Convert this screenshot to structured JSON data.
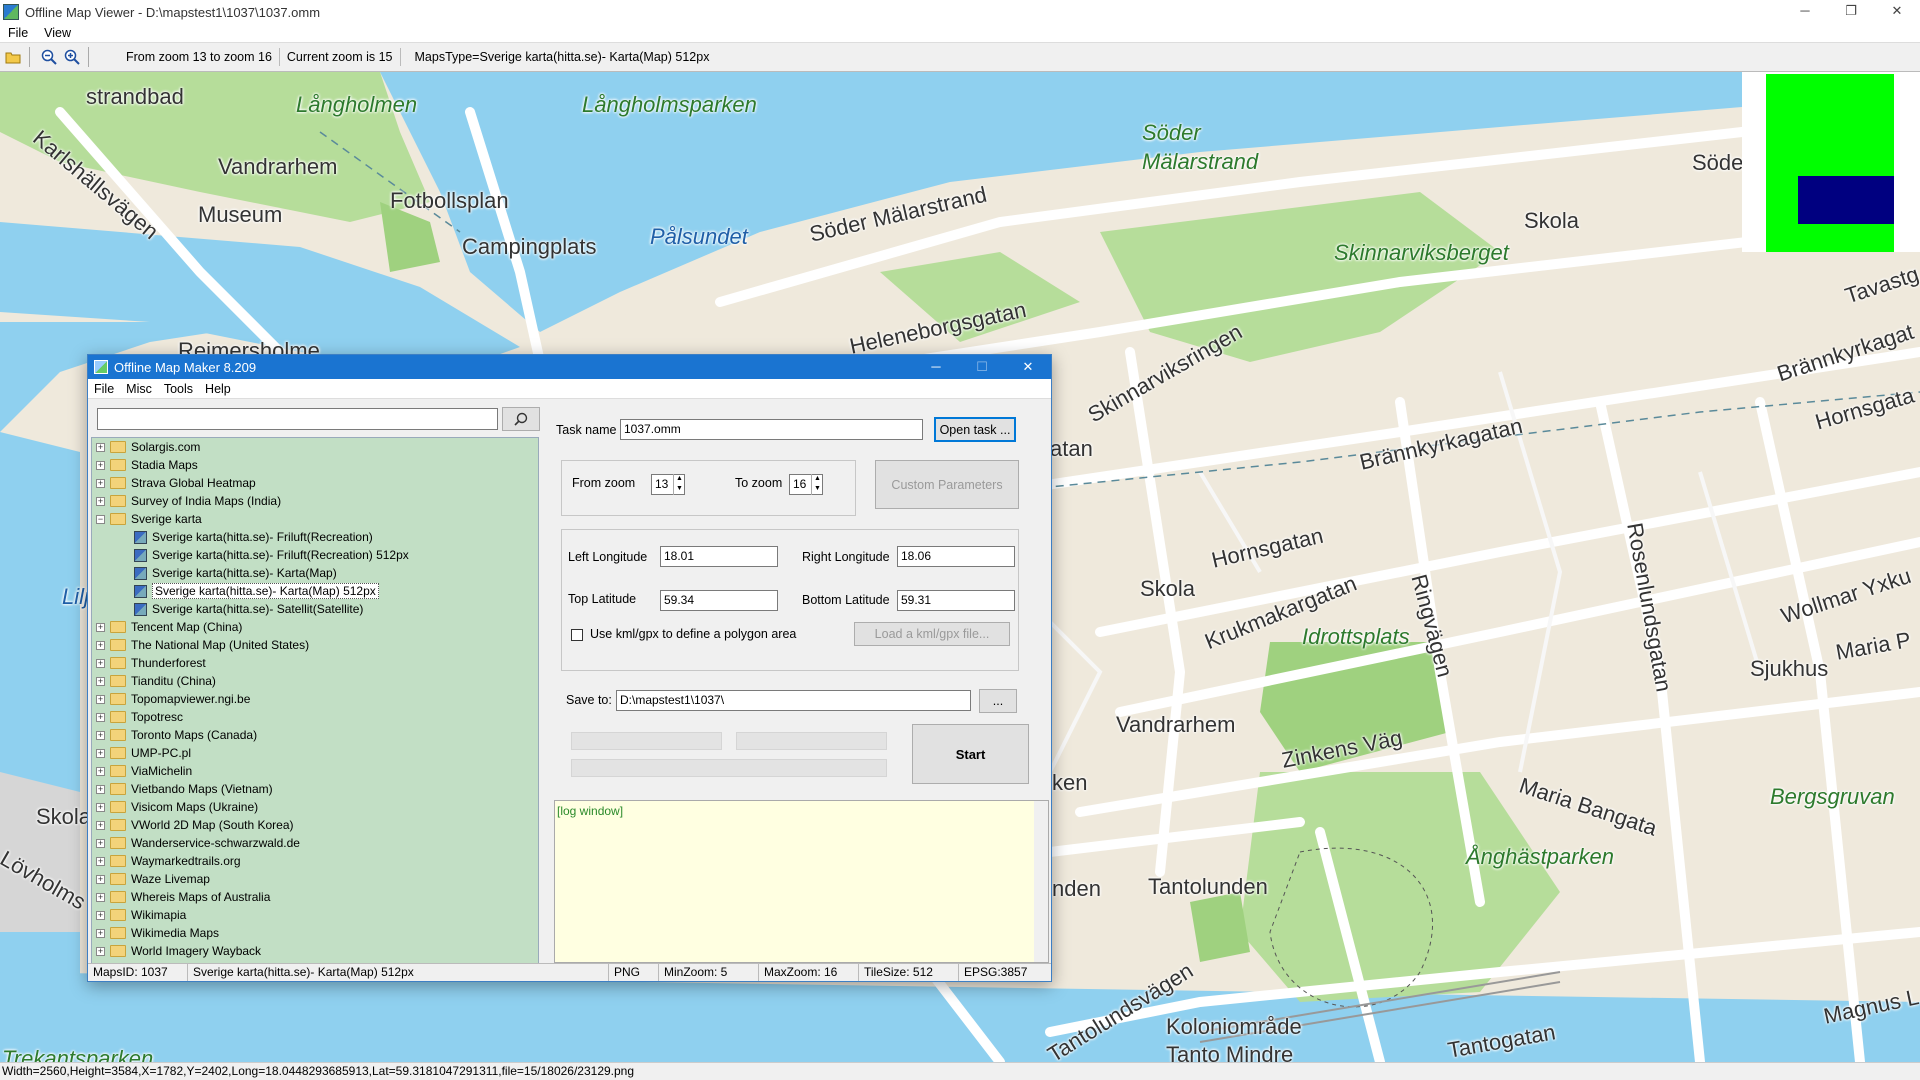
{
  "window": {
    "title": "Offline Map Viewer - D:\\mapstest1\\1037\\1037.omm",
    "minimize": "─",
    "restore": "❐",
    "close": "✕"
  },
  "menu": {
    "file": "File",
    "view": "View"
  },
  "toolbar": {
    "zoom_range": "From zoom 13 to zoom 16",
    "current_zoom": "Current zoom is 15",
    "maps_type": "MapsType=Sverige karta(hitta.se)- Karta(Map) 512px"
  },
  "map_labels": {
    "l1": "strandbad",
    "l2": "Långholmen",
    "l3": "Långholmsparken",
    "l4": "Söder",
    "l5": "Mälarstrand",
    "l6": "Vandrarhem",
    "l7": "Museum",
    "l8": "Fotbollsplan",
    "l9": "Campingplats",
    "l10": "Pålsundet",
    "l11": "Söder Mälarstrand",
    "l12": "Skola",
    "l13": "Skinnarviksberget",
    "l14": "Heleneborgsgatan",
    "l15": "Skinnarviksringen",
    "l16": "Tavastg",
    "l17": "Brännkyrkagat",
    "l18": "Hornsgata",
    "l19": "Brännkyrkagatan",
    "l20": "Hornsgatan",
    "l21": "Skola",
    "l22": "Krukmakargatan",
    "l23": "Idrottsplats",
    "l24": "Ringvägen",
    "l25": "Rosenlundsgatan",
    "l26": "Wollmar Yxku",
    "l27": "Sjukhus",
    "l28": "Maria P",
    "l29": "Vandrarhem",
    "l30": "Zinkens Väg",
    "l31": "Maria Bangata",
    "l32": "Bergsgruvan",
    "l33": "Tantolunden",
    "l34": "Ånghästparken",
    "l35": "Koloniområde",
    "l36": "Tanto Mindre",
    "l37": "Tantogatan",
    "l38": "Tantolundsvägen",
    "l39": "Magnus L",
    "l40": "Karlshällsvägen",
    "l41": "Skola",
    "l42": "Lövholms",
    "l43": "Lilj",
    "l44": "Söde",
    "l45": "Trekantsparken",
    "l46": "Reimersholme",
    "l47": "atan",
    "l48": "ken",
    "l49": "nden"
  },
  "statusbar": {
    "text": "Width=2560,Height=3584,X=1782,Y=2402,Long=18.0448293685913,Lat=59.3181047291311,file=15/18026/23129.png"
  },
  "dialog": {
    "title": "Offline Map Maker 8.209",
    "menu": [
      "File",
      "Misc",
      "Tools",
      "Help"
    ],
    "search": {
      "value": "",
      "icon": "search-icon"
    },
    "tree": [
      {
        "label": "Solargis.com",
        "type": "folder"
      },
      {
        "label": "Stadia Maps",
        "type": "folder"
      },
      {
        "label": "Strava Global Heatmap",
        "type": "folder"
      },
      {
        "label": "Survey of India Maps (India)",
        "type": "folder"
      },
      {
        "label": "Sverige karta",
        "type": "folder-open"
      },
      {
        "label": "Sverige karta(hitta.se)- Friluft(Recreation)",
        "type": "map"
      },
      {
        "label": "Sverige karta(hitta.se)- Friluft(Recreation) 512px",
        "type": "map"
      },
      {
        "label": "Sverige karta(hitta.se)- Karta(Map)",
        "type": "map"
      },
      {
        "label": "Sverige karta(hitta.se)- Karta(Map) 512px",
        "type": "map-selected"
      },
      {
        "label": "Sverige karta(hitta.se)- Satellit(Satellite)",
        "type": "map"
      },
      {
        "label": "Tencent Map (China)",
        "type": "folder"
      },
      {
        "label": "The National Map (United States)",
        "type": "folder"
      },
      {
        "label": "Thunderforest",
        "type": "folder"
      },
      {
        "label": "Tianditu (China)",
        "type": "folder"
      },
      {
        "label": "Topomapviewer.ngi.be",
        "type": "folder"
      },
      {
        "label": "Topotresc",
        "type": "folder"
      },
      {
        "label": "Toronto Maps (Canada)",
        "type": "folder"
      },
      {
        "label": "UMP-PC.pl",
        "type": "folder"
      },
      {
        "label": "ViaMichelin",
        "type": "folder"
      },
      {
        "label": "Vietbando Maps (Vietnam)",
        "type": "folder"
      },
      {
        "label": "Visicom Maps (Ukraine)",
        "type": "folder"
      },
      {
        "label": "VWorld 2D Map (South Korea)",
        "type": "folder"
      },
      {
        "label": "Wanderservice-schwarzwald.de",
        "type": "folder"
      },
      {
        "label": "Waymarkedtrails.org",
        "type": "folder"
      },
      {
        "label": "Waze Livemap",
        "type": "folder"
      },
      {
        "label": "Whereis Maps of Australia",
        "type": "folder"
      },
      {
        "label": "Wikimapia",
        "type": "folder"
      },
      {
        "label": "Wikimedia Maps",
        "type": "folder"
      },
      {
        "label": "World Imagery Wayback",
        "type": "folder"
      }
    ],
    "task_name_label": "Task name",
    "task_name_value": "1037.omm",
    "open_task": "Open task ...",
    "from_zoom_label": "From zoom",
    "from_zoom_value": "13",
    "to_zoom_label": "To zoom",
    "to_zoom_value": "16",
    "custom_params": "Custom Parameters",
    "left_lon_label": "Left Longitude",
    "left_lon_value": "18.01",
    "right_lon_label": "Right Longitude",
    "right_lon_value": "18.06",
    "top_lat_label": "Top Latitude",
    "top_lat_value": "59.34",
    "bottom_lat_label": "Bottom Latitude",
    "bottom_lat_value": "59.31",
    "kml_label": "Use kml/gpx to define a polygon area",
    "load_kml": "Load a kml/gpx file...",
    "save_to_label": "Save to:",
    "save_to_value": "D:\\mapstest1\\1037\\",
    "browse": "...",
    "start": "Start",
    "log": "[log window]",
    "status": {
      "maps_id": "MapsID: 1037",
      "maps_name": "Sverige karta(hitta.se)- Karta(Map) 512px",
      "format": "PNG",
      "min_zoom": "MinZoom: 5",
      "max_zoom": "MaxZoom: 16",
      "tile_size": "TileSize: 512",
      "epsg": "EPSG:3857"
    }
  },
  "colors": {
    "water": "#8fd0ef",
    "park": "#b6dd9a",
    "land": "#efe9dc",
    "road": "#ffffff",
    "accent": "#1a74d1",
    "tree_bg": "#c2dfc5",
    "log_bg": "#ffffe1"
  }
}
